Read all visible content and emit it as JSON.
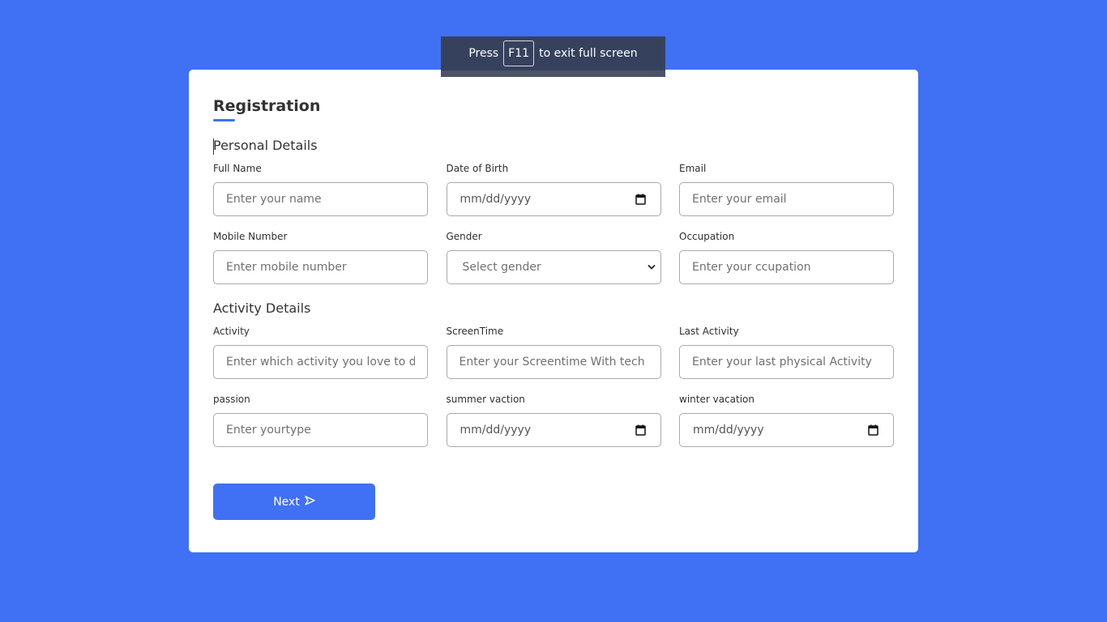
{
  "fullscreen_banner": {
    "press": "Press",
    "key": "F11",
    "suffix": "to exit full screen"
  },
  "form": {
    "title": "Registration",
    "sections": [
      {
        "title": "Personal Details",
        "fields": [
          {
            "label": "Full Name",
            "placeholder": "Enter your name",
            "type": "text"
          },
          {
            "label": "Date of Birth",
            "placeholder": "mm/dd/yyyy",
            "type": "date"
          },
          {
            "label": "Email",
            "placeholder": "Enter your email",
            "type": "text"
          },
          {
            "label": "Mobile Number",
            "placeholder": "Enter mobile number",
            "type": "text"
          },
          {
            "label": "Gender",
            "placeholder": "Select gender",
            "type": "select"
          },
          {
            "label": "Occupation",
            "placeholder": "Enter your ccupation",
            "type": "text"
          }
        ]
      },
      {
        "title": "Activity Details",
        "fields": [
          {
            "label": "Activity",
            "placeholder": "Enter which activity you love to do",
            "type": "text"
          },
          {
            "label": "ScreenTime",
            "placeholder": "Enter your Screentime With tech",
            "type": "text"
          },
          {
            "label": "Last Activity",
            "placeholder": "Enter your last physical Activity",
            "type": "text"
          },
          {
            "label": "passion",
            "placeholder": "Enter yourtype",
            "type": "text"
          },
          {
            "label": "summer vaction",
            "placeholder": "mm/dd/yyyy",
            "type": "date"
          },
          {
            "label": "winter vacation",
            "placeholder": "mm/dd/yyyy",
            "type": "date"
          }
        ]
      }
    ],
    "next_button": {
      "label": "Next",
      "icon": "send-arrow-icon"
    }
  },
  "colors": {
    "background": "#4070f4",
    "accent": "#4070f4",
    "card": "#ffffff",
    "banner": "#36425d"
  }
}
